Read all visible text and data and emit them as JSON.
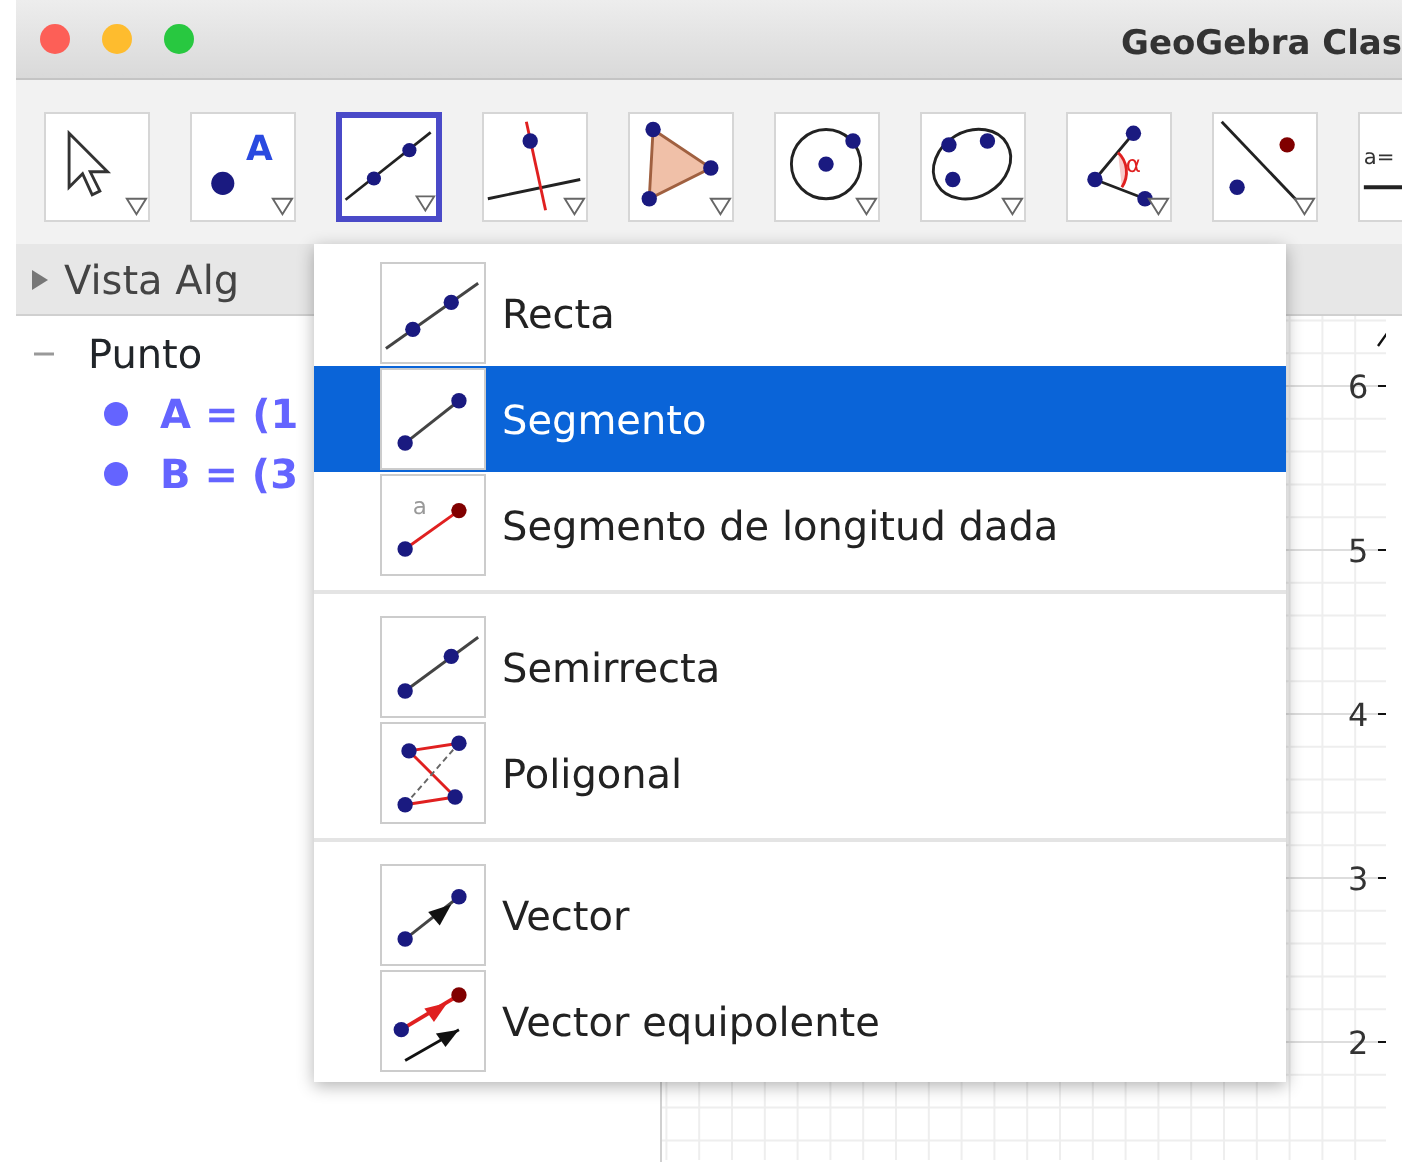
{
  "window": {
    "title": "GeoGebra Clas"
  },
  "toolbar": [
    {
      "kind": "pointer",
      "selected": false
    },
    {
      "kind": "point",
      "selected": false,
      "glyph": "A"
    },
    {
      "kind": "segment",
      "selected": true
    },
    {
      "kind": "perpendicular",
      "selected": false
    },
    {
      "kind": "polygon",
      "selected": false
    },
    {
      "kind": "circle",
      "selected": false
    },
    {
      "kind": "conic",
      "selected": false
    },
    {
      "kind": "angle",
      "selected": false,
      "glyph": "α"
    },
    {
      "kind": "reflect",
      "selected": false
    },
    {
      "kind": "slider",
      "selected": false,
      "glyph": "a="
    }
  ],
  "algebra_view": {
    "title": "Vista Alg",
    "groups": [
      {
        "label": "Punto",
        "expanded": true,
        "children": [
          {
            "label": "A = (1",
            "color": "#6464ff"
          },
          {
            "label": "B = (3",
            "color": "#6464ff"
          }
        ]
      }
    ]
  },
  "graphics_view": {
    "y_labels": [
      "6",
      "5",
      "4",
      "3",
      "2"
    ]
  },
  "tool_menu": {
    "groups": [
      [
        {
          "label": "Recta",
          "kind": "line",
          "selected": false
        },
        {
          "label": "Segmento",
          "kind": "segment",
          "selected": true
        },
        {
          "label": "Segmento de longitud dada",
          "kind": "fixed-segment",
          "selected": false,
          "glyph": "a"
        }
      ],
      [
        {
          "label": "Semirrecta",
          "kind": "ray",
          "selected": false
        },
        {
          "label": "Poligonal",
          "kind": "polyline",
          "selected": false
        }
      ],
      [
        {
          "label": "Vector",
          "kind": "vector",
          "selected": false
        },
        {
          "label": "Vector equipolente",
          "kind": "vector-from-point",
          "selected": false
        }
      ]
    ]
  }
}
